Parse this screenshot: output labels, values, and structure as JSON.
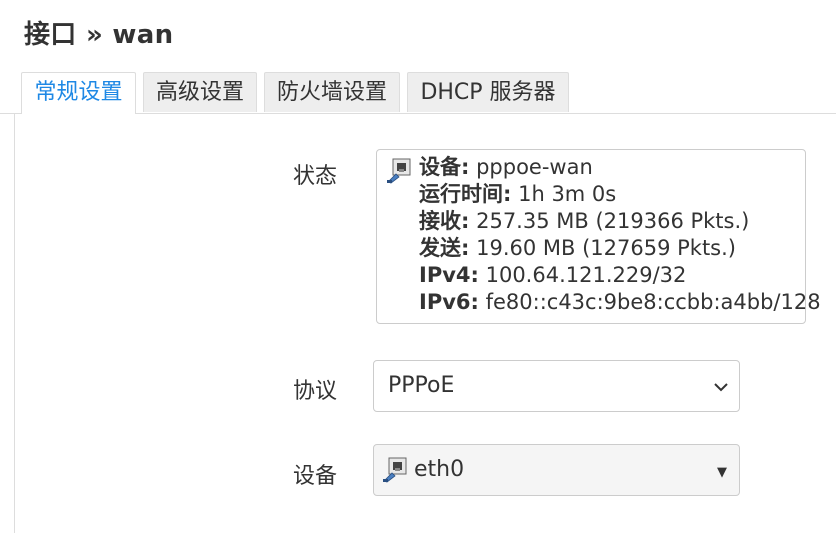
{
  "page": {
    "title": "接口 » wan"
  },
  "tabs": [
    {
      "label": "常规设置",
      "active": true
    },
    {
      "label": "高级设置"
    },
    {
      "label": "防火墙设置"
    },
    {
      "label": "DHCP 服务器"
    }
  ],
  "status": {
    "label": "状态",
    "icon": "ethernet-port-icon",
    "lines": [
      {
        "key": "设备:",
        "value": "pppoe-wan"
      },
      {
        "key": "运行时间:",
        "value": "1h 3m 0s"
      },
      {
        "key": "接收:",
        "value": "257.35 MB (219366 Pkts.)"
      },
      {
        "key": "发送:",
        "value": "19.60 MB (127659 Pkts.)"
      },
      {
        "key": "IPv4:",
        "value": "100.64.121.229/32"
      },
      {
        "key": "IPv6:",
        "value": "fe80::c43c:9be8:ccbb:a4bb/128"
      }
    ]
  },
  "protocol": {
    "label": "协议",
    "value": "PPPoE"
  },
  "device": {
    "label": "设备",
    "value": "eth0",
    "icon": "ethernet-port-icon"
  },
  "colors": {
    "accent": "#1e88e5",
    "border": "#cccccc",
    "tab_bg": "#eeeeee"
  }
}
